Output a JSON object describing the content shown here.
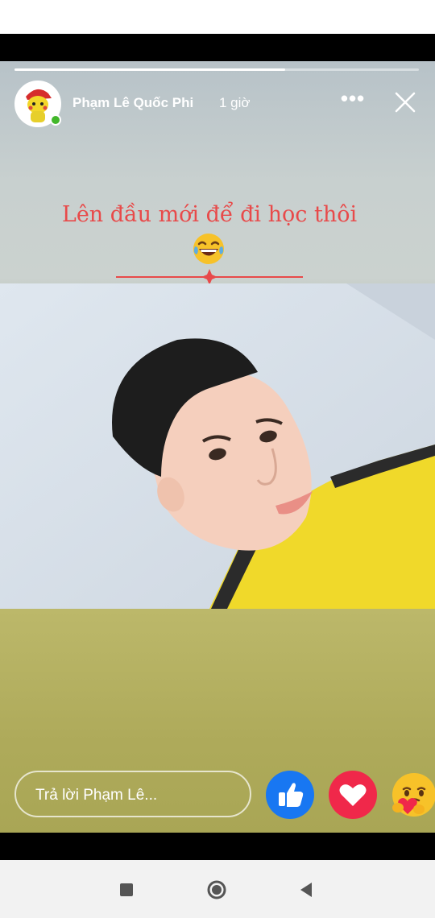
{
  "story": {
    "progress": 0.67,
    "author": "Phạm Lê Quốc Phi",
    "time": "1 giờ",
    "caption": "Lên đầu mới để đi học thôi",
    "caption_color": "#e84a4a"
  },
  "reply": {
    "placeholder": "Trả lời Phạm Lê..."
  },
  "reactions": [
    {
      "name": "like-icon",
      "color": "#1877f2"
    },
    {
      "name": "love-icon",
      "color": "#f0284a"
    },
    {
      "name": "care-icon",
      "color": "#f7c229"
    }
  ],
  "nav": [
    "recents-icon",
    "home-icon",
    "back-icon"
  ]
}
